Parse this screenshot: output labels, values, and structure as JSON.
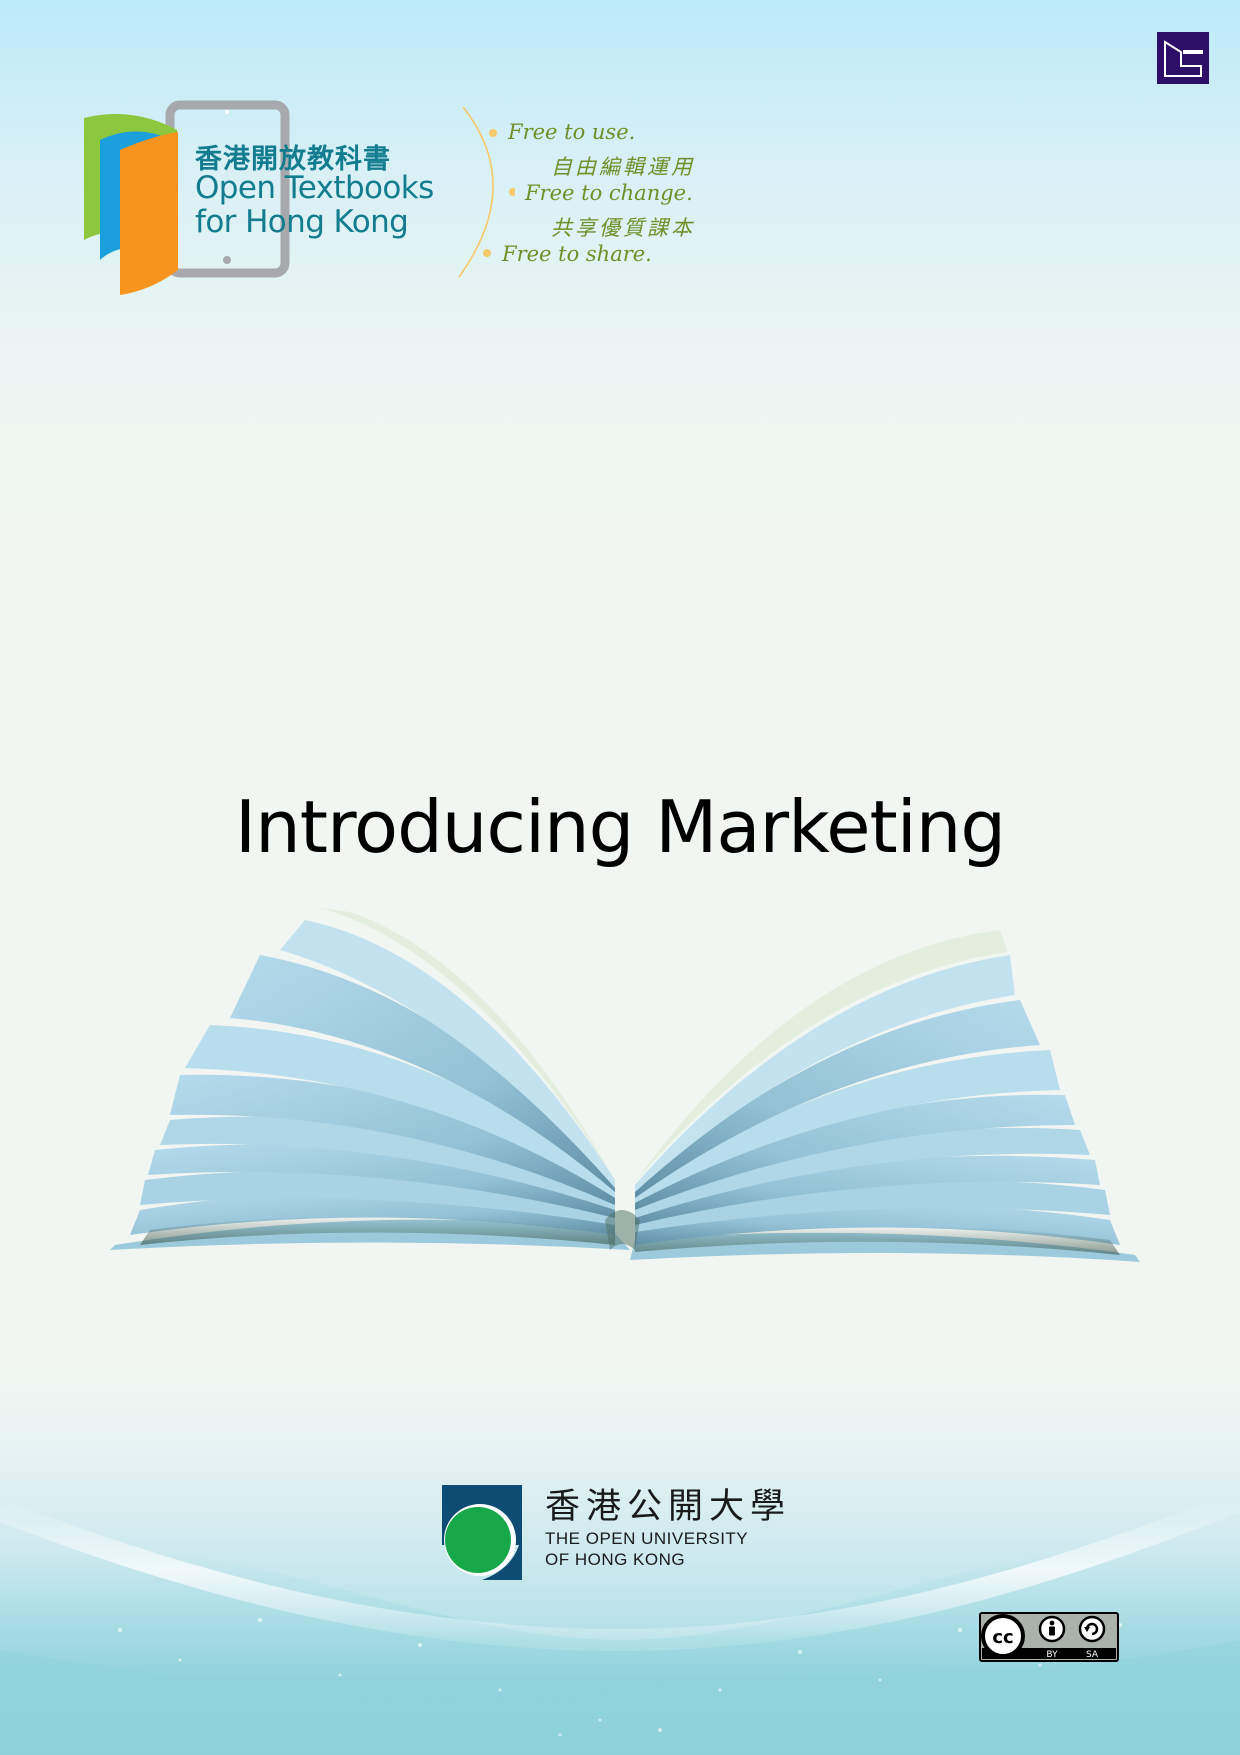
{
  "brand": {
    "chinese_name": "香港開放教科書",
    "name_line1": "Open Textbooks",
    "name_line2": "for Hong Kong",
    "colors": {
      "teal": "#137d8f",
      "orange": "#f7941d",
      "blue": "#1ba0dc",
      "green": "#8dc63f",
      "gray": "#a7a9ac"
    }
  },
  "slogans": {
    "free_to_use": "Free to use.",
    "cn_line1": "自由編輯運用",
    "free_to_change": "Free to change.",
    "cn_line2": "共享優質課本",
    "free_to_share": "Free to share."
  },
  "cover": {
    "title": "Introducing Marketing"
  },
  "university": {
    "chinese_name": "香港公開大學",
    "name_line1": "THE OPEN UNIVERSITY",
    "name_line2": "OF HONG KONG",
    "colors": {
      "navy": "#0f4c73",
      "green": "#17a84a"
    }
  },
  "license": {
    "icons": [
      "cc-icon",
      "by-icon",
      "sa-icon"
    ],
    "by_label": "BY",
    "sa_label": "SA"
  },
  "corner_mark_color": "#2d0f67"
}
